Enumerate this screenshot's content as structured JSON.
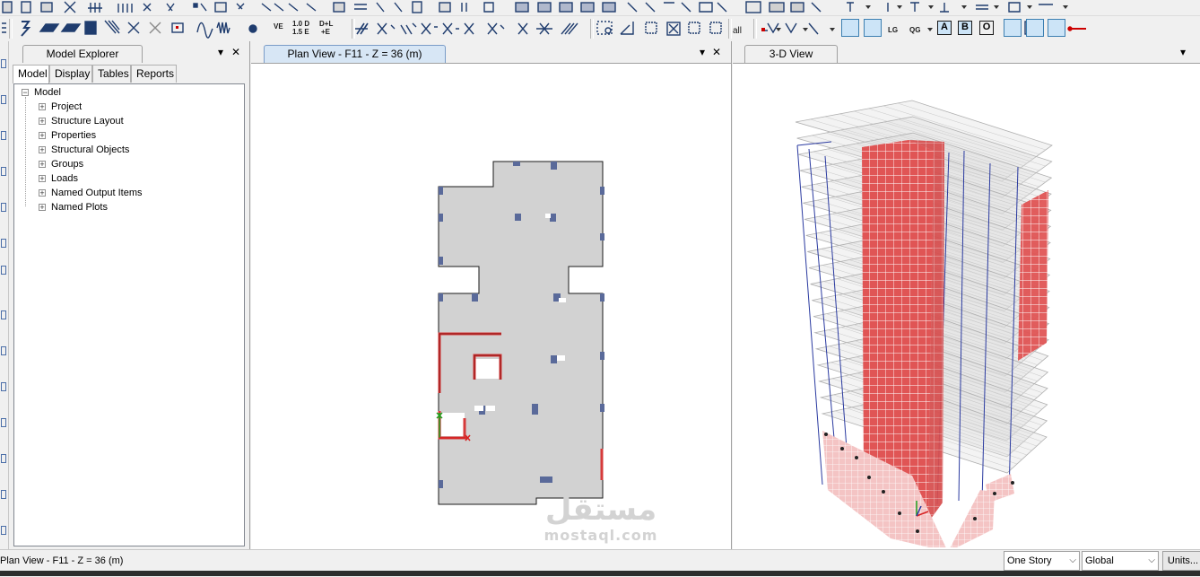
{
  "toolbar_row2": {
    "unit_labels": [
      "VE",
      "1.0 D",
      "1.5 E",
      "D+L",
      "+E"
    ],
    "load_case_labels": [
      "LG",
      "QG"
    ],
    "view_toggle_letters": [
      "A",
      "B",
      "O"
    ],
    "all_label": "all"
  },
  "explorer": {
    "title": "Model Explorer",
    "tabs": [
      "Model",
      "Display",
      "Tables",
      "Reports"
    ],
    "active_tab": "Model",
    "root": "Model",
    "items": [
      "Project",
      "Structure Layout",
      "Properties",
      "Structural Objects",
      "Groups",
      "Loads",
      "Named Output Items",
      "Named Plots"
    ]
  },
  "plan_view": {
    "title": "Plan View - F11 - Z = 36 (m)"
  },
  "view_3d": {
    "title": "3-D View"
  },
  "status": {
    "text": "Plan View - F11 - Z = 36 (m)",
    "story_option": "One Story",
    "coord_option": "Global",
    "units_button": "Units..."
  },
  "watermark": {
    "arabic": "مستقل",
    "latin": "mostaql.com"
  },
  "colors": {
    "slab_fill": "#d2d2d2",
    "column": "#5a6a9a",
    "wall_red": "#d63a3a",
    "shell_red": "#e05555",
    "frame_blue": "#2a3aa0",
    "active_tab": "#d7e6f5"
  }
}
